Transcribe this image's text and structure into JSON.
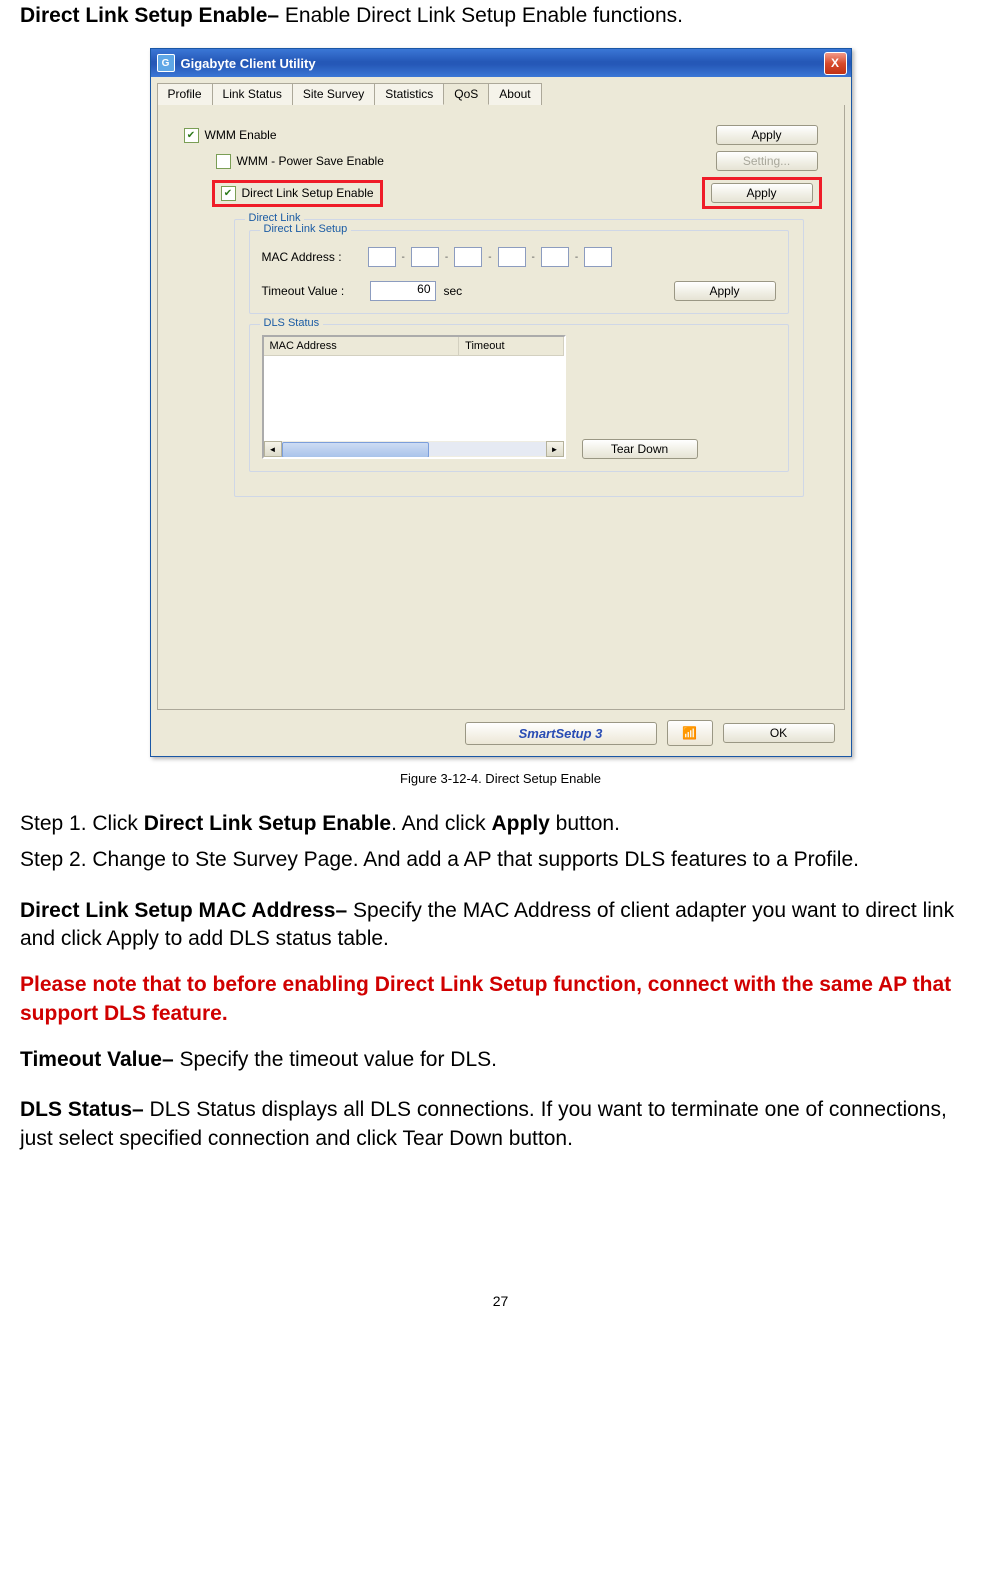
{
  "intro": {
    "title": "Direct Link Setup Enable– ",
    "desc": "Enable Direct Link Setup Enable functions."
  },
  "window": {
    "title": "Gigabyte Client Utility",
    "close": "X",
    "tabs": [
      "Profile",
      "Link Status",
      "Site Survey",
      "Statistics",
      "QoS",
      "About"
    ],
    "active_tab": 4,
    "wmm_enable": "WMM Enable",
    "wmm_ps": "WMM - Power Save Enable",
    "dls_enable": "Direct Link Setup Enable",
    "apply": "Apply",
    "setting": "Setting...",
    "group_direct_link": "Direct Link",
    "group_setup": "Direct Link Setup",
    "mac_label": "MAC Address :",
    "timeout_label": "Timeout Value :",
    "timeout_value": "60",
    "timeout_unit": "sec",
    "group_dls_status": "DLS Status",
    "col_mac": "MAC Address",
    "col_timeout": "Timeout",
    "tear_down": "Tear Down",
    "smart_setup": "SmartSetup 3",
    "ok": "OK"
  },
  "caption": "Figure 3-12-4.    Direct Setup Enable",
  "step1_a": "Step 1. Click ",
  "step1_b": "Direct Link Setup Enable",
  "step1_c": ". And click ",
  "step1_d": "Apply",
  "step1_e": " button.",
  "step2": "Step 2. Change to Ste Survey Page. And add a AP that supports DLS features to a Profile.",
  "mac_title": "Direct Link Setup MAC Address– ",
  "mac_desc": "Specify the MAC Address of client adapter you want to direct link and click Apply to add DLS status table.",
  "note": "Please note that to before enabling Direct Link Setup function, connect with the same AP that support DLS feature.",
  "timeout_title": "Timeout Value– ",
  "timeout_desc": "Specify the timeout value for DLS.",
  "dls_title": "DLS Status– ",
  "dls_desc": "DLS Status displays all DLS connections. If you want to terminate one of connections, just select specified connection and click Tear Down button.",
  "page_number": "27"
}
